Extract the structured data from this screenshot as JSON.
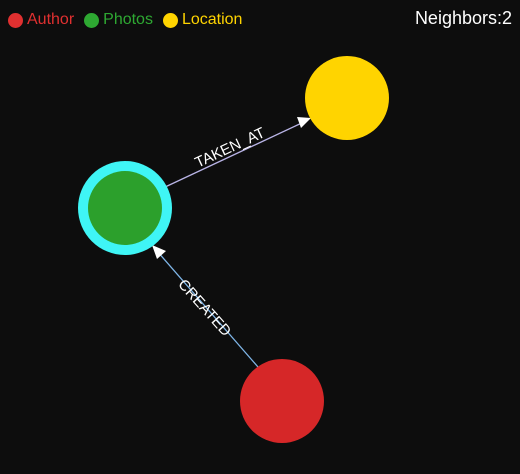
{
  "legend": [
    {
      "label": "Author",
      "color": "#e03030"
    },
    {
      "label": "Photos",
      "color": "#2ea832"
    },
    {
      "label": "Location",
      "color": "#ffd400"
    }
  ],
  "neighbors_label": "Neighbors:2",
  "colors": {
    "background": "#0d0d0d",
    "selected_ring": "#3ff5f5",
    "author_node": "#d62728",
    "photos_node": "#2ca02c",
    "location_node": "#ffd400",
    "edge_taken_at": "#b9b4e6",
    "edge_created": "#7fb6e8",
    "arrow": "#ffffff",
    "label_text": "#ffffff"
  },
  "graph": {
    "nodes": [
      {
        "id": "photos",
        "type": "Photos",
        "selected": true
      },
      {
        "id": "location",
        "type": "Location",
        "selected": false
      },
      {
        "id": "author",
        "type": "Author",
        "selected": false
      }
    ],
    "edges": [
      {
        "source": "photos",
        "target": "location",
        "label": "TAKEN_AT"
      },
      {
        "source": "author",
        "target": "photos",
        "label": "CREATED"
      }
    ]
  }
}
